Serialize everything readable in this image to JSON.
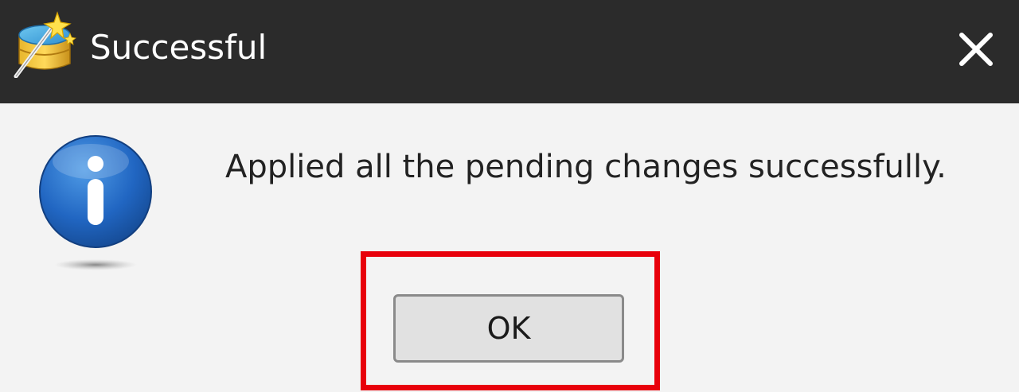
{
  "dialog": {
    "title": "Successful",
    "message": "Applied all the pending changes successfully.",
    "ok_label": "OK",
    "close_symbol": "✕",
    "info_symbol": "i"
  },
  "icons": {
    "app": "database-wand-icon",
    "info": "info-icon",
    "close": "close-icon"
  },
  "colors": {
    "titlebar": "#2b2b2b",
    "background": "#f3f3f3",
    "highlight": "#e8000b",
    "info_blue": "#1e5fb4"
  }
}
